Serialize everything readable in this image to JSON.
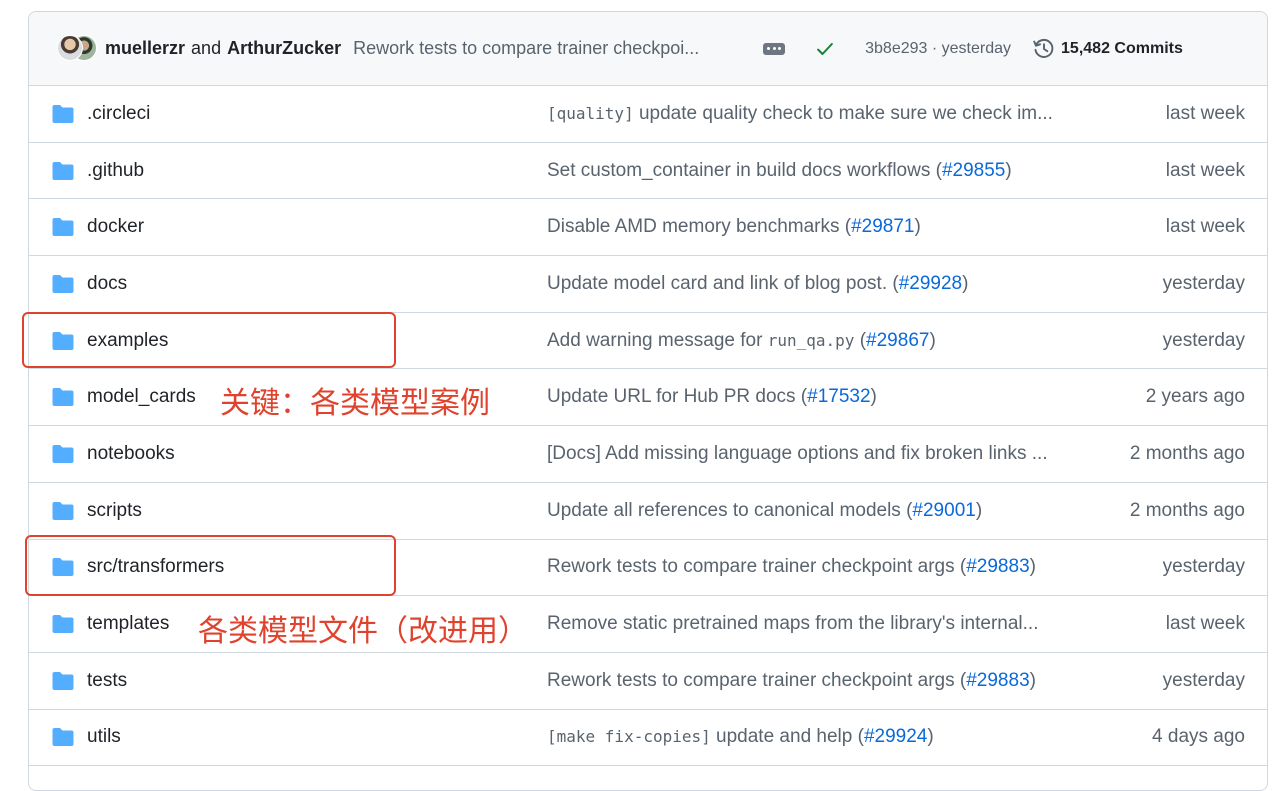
{
  "header": {
    "author1": "muellerzr",
    "and_text": "and",
    "author2": "ArthurZucker",
    "commit_message": "Rework tests to compare trainer checkpoi...",
    "sha": "3b8e293",
    "separator": "·",
    "time": "yesterday",
    "commits": "15,482 Commits"
  },
  "files": [
    {
      "name": ".circleci",
      "pre": "",
      "code": "[quality]",
      "msg": " update quality check to make sure we check im...",
      "code2": "",
      "post": "",
      "pr": "",
      "tail": "",
      "date": "last week"
    },
    {
      "name": ".github",
      "pre": "Set custom_container in build docs workflows (",
      "code": "",
      "msg": "",
      "code2": "",
      "post": "",
      "pr": "#29855",
      "tail": ")",
      "date": "last week"
    },
    {
      "name": "docker",
      "pre": "Disable AMD memory benchmarks (",
      "code": "",
      "msg": "",
      "code2": "",
      "post": "",
      "pr": "#29871",
      "tail": ")",
      "date": "last week"
    },
    {
      "name": "docs",
      "pre": "Update model card and link of blog post. (",
      "code": "",
      "msg": "",
      "code2": "",
      "post": "",
      "pr": "#29928",
      "tail": ")",
      "date": "yesterday"
    },
    {
      "name": "examples",
      "pre": "Add warning message for ",
      "code": "run_qa.py",
      "msg": " (",
      "code2": "",
      "post": "",
      "pr": "#29867",
      "tail": ")",
      "date": "yesterday"
    },
    {
      "name": "model_cards",
      "pre": "Update URL for Hub PR docs (",
      "code": "",
      "msg": "",
      "code2": "",
      "post": "",
      "pr": "#17532",
      "tail": ")",
      "date": "2 years ago"
    },
    {
      "name": "notebooks",
      "pre": "[Docs] Add missing language options and fix broken links ...",
      "code": "",
      "msg": "",
      "code2": "",
      "post": "",
      "pr": "",
      "tail": "",
      "date": "2 months ago"
    },
    {
      "name": "scripts",
      "pre": "Update all references to canonical models (",
      "code": "",
      "msg": "",
      "code2": "",
      "post": "",
      "pr": "#29001",
      "tail": ")",
      "date": "2 months ago"
    },
    {
      "name": "src/transformers",
      "pre": "Rework tests to compare trainer checkpoint args (",
      "code": "",
      "msg": "",
      "code2": "",
      "post": "",
      "pr": "#29883",
      "tail": ")",
      "date": "yesterday"
    },
    {
      "name": "templates",
      "pre": "Remove static pretrained maps from the library's internal...",
      "code": "",
      "msg": "",
      "code2": "",
      "post": "",
      "pr": "",
      "tail": "",
      "date": "last week"
    },
    {
      "name": "tests",
      "pre": "Rework tests to compare trainer checkpoint args (",
      "code": "",
      "msg": "",
      "code2": "",
      "post": "",
      "pr": "#29883",
      "tail": ")",
      "date": "yesterday"
    },
    {
      "name": "utils",
      "pre": "",
      "code": "[make fix-copies]",
      "msg": " update and help (",
      "code2": "",
      "post": "",
      "pr": "#29924",
      "tail": ")",
      "date": "4 days ago"
    }
  ],
  "annotations": {
    "label1": "关键：各类模型案例",
    "label2": "各类模型文件（改进用）"
  },
  "colors": {
    "folder": "#54aeff",
    "link": "#0969da",
    "annotation": "#e0432d",
    "check": "#1a7f37"
  }
}
